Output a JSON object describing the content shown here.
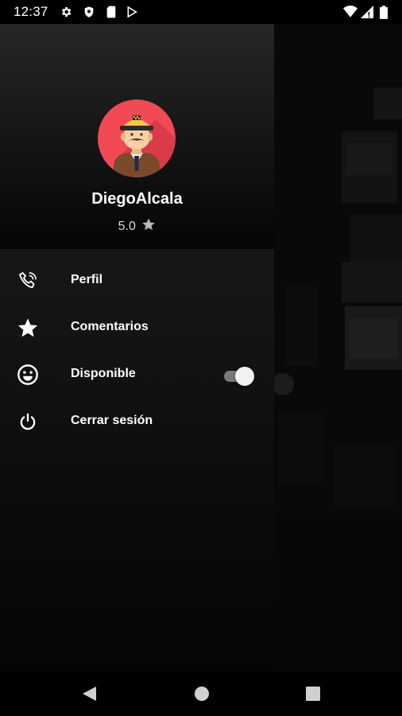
{
  "status_bar": {
    "time": "12:37",
    "left_icons": [
      "settings-icon",
      "shield-icon",
      "sim-card-icon",
      "play-store-icon"
    ],
    "right_icons": [
      "wifi-icon",
      "signal-icon",
      "battery-icon"
    ]
  },
  "drawer": {
    "driver_name": "DiegoAlcala",
    "rating": "5.0",
    "menu": [
      {
        "label": "Perfil",
        "icon": "phone-icon"
      },
      {
        "label": "Comentarios",
        "icon": "star-icon"
      },
      {
        "label": "Disponible",
        "icon": "smiley-icon",
        "toggle_on": true
      },
      {
        "label": "Cerrar sesión",
        "icon": "power-icon"
      }
    ]
  },
  "nav_bar": {
    "buttons": [
      "back-button",
      "home-button",
      "recents-button"
    ]
  },
  "colors": {
    "avatar_background": "#F24A55",
    "toggle_thumb": "#F1F1F1",
    "toggle_track": "#7A7A7A",
    "text": "#FFFFFF"
  }
}
